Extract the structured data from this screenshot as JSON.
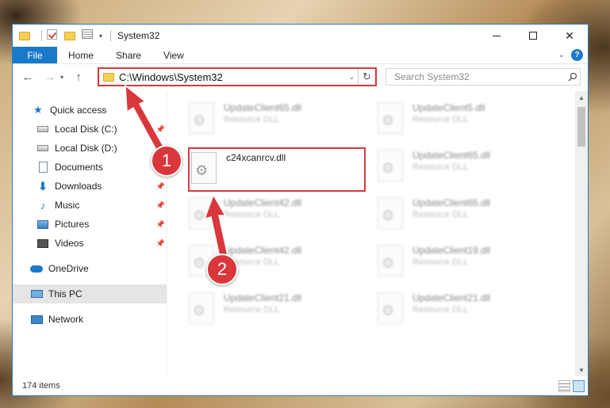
{
  "window": {
    "title": "System32",
    "controls": [
      "minimize",
      "maximize",
      "close"
    ]
  },
  "ribbon": {
    "file_tab": "File",
    "tabs": [
      "Home",
      "Share",
      "View"
    ]
  },
  "navigation": {
    "address_path": "C:\\Windows\\System32",
    "search_placeholder": "Search System32"
  },
  "sidebar": {
    "items": [
      {
        "label": "Quick access",
        "icon": "star-icon"
      },
      {
        "label": "Local Disk (C:)",
        "icon": "drive-icon",
        "pinned": true
      },
      {
        "label": "Local Disk (D:)",
        "icon": "drive-icon"
      },
      {
        "label": "Documents",
        "icon": "documents-icon"
      },
      {
        "label": "Downloads",
        "icon": "download-arrow-icon",
        "pinned": true
      },
      {
        "label": "Music",
        "icon": "music-note-icon",
        "pinned": true
      },
      {
        "label": "Pictures",
        "icon": "pictures-icon",
        "pinned": true
      },
      {
        "label": "Videos",
        "icon": "videos-icon",
        "pinned": true
      },
      {
        "label": "OneDrive",
        "icon": "cloud-icon"
      },
      {
        "label": "This PC",
        "icon": "computer-icon",
        "selected": true
      },
      {
        "label": "Network",
        "icon": "network-icon"
      }
    ]
  },
  "files": [
    {
      "name": "UpdateClient65.dll",
      "type": "Resource DLL"
    },
    {
      "name": "UpdateClient5.dll",
      "type": "Resource DLL"
    },
    {
      "name": "c24xcanrcv.dll",
      "type": ""
    },
    {
      "name": "UpdateClient65.dll",
      "type": "Resource DLL"
    },
    {
      "name": "UpdateClient42.dll",
      "type": "Resource DLL"
    },
    {
      "name": "UpdateClient65.dll",
      "type": "Resource DLL"
    },
    {
      "name": "UpdateClient42.dll",
      "type": "Resource DLL"
    },
    {
      "name": "UpdateClient19.dll",
      "type": "Resource DLL"
    },
    {
      "name": "UpdateClient21.dll",
      "type": "Resource DLL"
    },
    {
      "name": "UpdateClient21.dll",
      "type": "Resource DLL"
    }
  ],
  "status": {
    "item_count": "174 items"
  },
  "annotations": {
    "step1": "1",
    "step2": "2",
    "highlight_color": "#d9373b"
  },
  "colors": {
    "accent": "#1979ca"
  }
}
